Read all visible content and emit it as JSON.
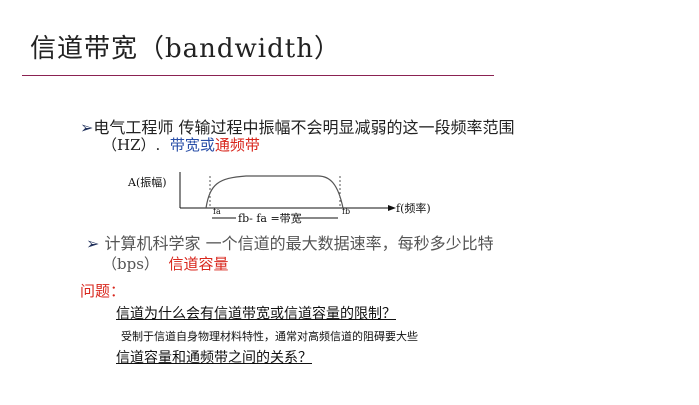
{
  "title": "信道带宽（bandwidth）",
  "bullet1": {
    "marker": "➢",
    "line1": "电气工程师 传输过程中振幅不会明显减弱的这一段频率范围",
    "line2_prefix": "（HZ）.  ",
    "line2_blue": "带宽或",
    "line2_red": "通频带"
  },
  "diagram": {
    "y_label": "A(振幅)",
    "x_label": "f(频率)",
    "left_marker": "fa",
    "right_marker": "fb",
    "range_label": "fb- fa =带宽"
  },
  "bullet2": {
    "marker": "➢",
    "line1": "计算机科学家 一个信道的最大数据速率，每秒多少比特",
    "line2_prefix": "（bps）  ",
    "line2_red": "信道容量"
  },
  "questions": {
    "label": "问题：",
    "q1": "信道为什么会有信道带宽或信道容量的限制？",
    "note": "受制于信道自身物理材料特性，通常对高频信道的阻碍要大些",
    "q2": "信道容量和通频带之间的关系？"
  }
}
